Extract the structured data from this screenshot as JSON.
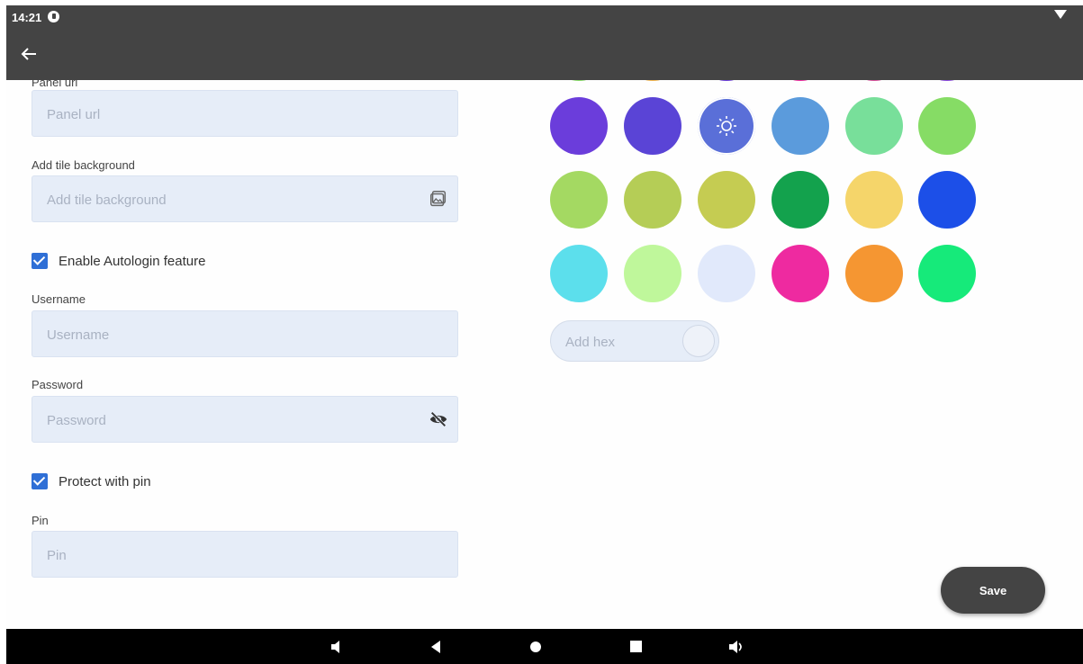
{
  "status_bar": {
    "time": "14:21"
  },
  "form": {
    "panel_url": {
      "label": "Panel url",
      "placeholder": "Panel url"
    },
    "tile_background": {
      "label": "Add tile background",
      "placeholder": "Add tile background",
      "icon": "image-icon"
    },
    "autologin": {
      "label": "Enable Autologin feature",
      "checked": true
    },
    "username": {
      "label": "Username",
      "placeholder": "Username"
    },
    "password": {
      "label": "Password",
      "placeholder": "Password",
      "icon": "eye-off-icon"
    },
    "protect_pin": {
      "label": "Protect with pin",
      "checked": true
    },
    "pin": {
      "label": "Pin",
      "placeholder": "Pin"
    }
  },
  "palette": {
    "selected_color": "#5a6fd8",
    "swatches": [
      "#6b3ddb",
      "#5a44d6",
      "#5a6fd8",
      "#5b9bdc",
      "#78df9a",
      "#86dc65",
      "#a4d962",
      "#b5cd56",
      "#c5cc52",
      "#13a24d",
      "#f5d56a",
      "#1c4fe8",
      "#5cdfec",
      "#bff79b",
      "#e1e9fb",
      "#ee2aa0",
      "#f59632",
      "#16ea7a"
    ],
    "hex_placeholder": "Add hex"
  },
  "actions": {
    "save_label": "Save"
  },
  "colors": {
    "appbar": "#444444",
    "field_bg": "#e6edf8",
    "checkbox": "#2f6fd6"
  }
}
